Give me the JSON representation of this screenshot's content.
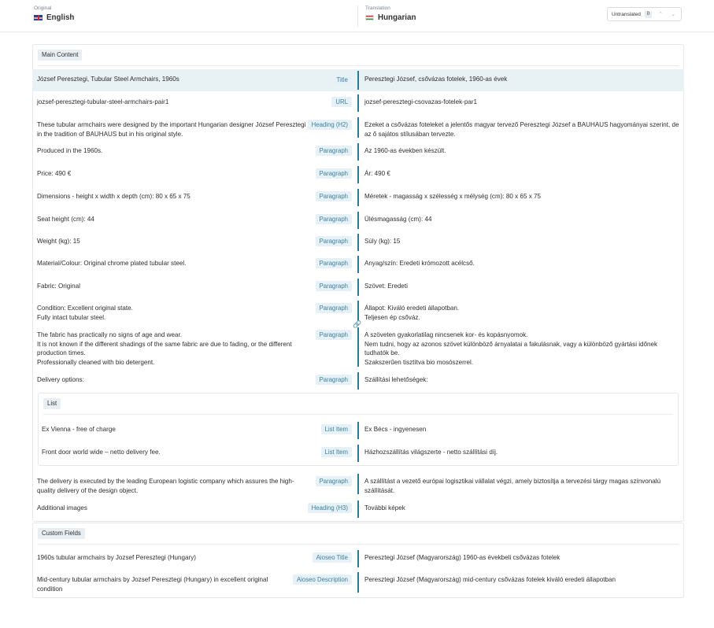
{
  "header": {
    "original_caption": "Original",
    "original_language": "English",
    "translation_caption": "Translation",
    "translation_language": "Hungarian",
    "untranslated_label": "Untranslated",
    "untranslated_count": "0",
    "prev_icon": "chevron-up-icon",
    "next_icon": "chevron-down-icon"
  },
  "main_content": {
    "label": "Main Content",
    "rows": [
      {
        "source": "József Peresztegi, Tubular Steel Armchairs, 1960s",
        "type": "Title",
        "translation": "Peresztegi József, csővázas fotelek, 1960-as évek"
      },
      {
        "source": "jozsef-peresztegi-tubular-steel-armchairs-pair1",
        "type": "URL",
        "translation": "jozsef-peresztegi-csovazas-fotelek-par1"
      },
      {
        "source": "These tubular armchairs were designed by the important Hungarian designer József Peresztegi in the tradition of BAUHAUS but in his original style.",
        "type": "Heading (H2)",
        "translation": "Ezeket a csővázas foteleket a jelentős magyar tervező Peresztegi József a BAUHAUS hagyományai szerint, de az ő sajátos stílusában tervezte."
      },
      {
        "source": "Produced in the 1960s.",
        "type": "Paragraph",
        "translation": "Az 1960-as években készült."
      },
      {
        "source": "Price: 490 €",
        "type": "Paragraph",
        "translation": "Ár: 490 €"
      },
      {
        "source": "Dimensions - height x width x depth (cm): 80 x 65 x 75",
        "type": "Paragraph",
        "translation": "Méretek - magasság x szélesség x mélység (cm): 80 x 65 x 75"
      },
      {
        "source": "Seat height (cm): 44",
        "type": "Paragraph",
        "translation": "Ülésmagasság (cm): 44"
      },
      {
        "source": "Weight (kg): 15",
        "type": "Paragraph",
        "translation": "Súly (kg): 15"
      },
      {
        "source": "Material/Colour: Original chrome plated tubular steel.",
        "type": "Paragraph",
        "translation": "Anyag/szín: Eredeti krómozott acélcső."
      },
      {
        "source": "Fabric: Original",
        "type": "Paragraph",
        "translation": "Szövet: Eredeti"
      },
      {
        "source": "Condition: Excellent original state.\nFully intact tubular steel.",
        "type": "Paragraph",
        "translation": "Állapot: Kiváló eredeti állapotban.\nTeljesen ép csőváz."
      },
      {
        "source": "The fabric has practically no signs of age and wear.\nIt is not known if the different shadings of the same fabric are due to fading, or the different production times.\nProfessionally cleaned with bio detergent.",
        "type": "Paragraph",
        "translation": "A szöveten gyakorlatilag nincsenek kor- és kopásnyomok.\nNem tudni, hogy az azonos szövet különböző árnyalatai a fakulásnak, vagy a különböző gyártási időnek tudhatók be.\nSzakszerűen tisztítva bio mosószerrel."
      },
      {
        "source": "Delivery options:",
        "type": "Paragraph",
        "translation": "Szállítási lehetőségek:"
      }
    ],
    "list": {
      "label": "List",
      "items": [
        {
          "source": "Ex Vienna - free of charge",
          "type": "List Item",
          "translation": "Ex Bécs - ingyenesen"
        },
        {
          "source": "Front door world wide – netto delivery fee.",
          "type": "List Item",
          "translation": "Házhozszállítás világszerte - netto szállítási díj."
        }
      ]
    },
    "after_rows": [
      {
        "source": "The delivery is executed by the leading European logistic company which assures the high-quality delivery of the design object.",
        "type": "Paragraph",
        "translation": "A szállítást a vezető európai logisztikai vállalat végzi, amely biztosítja a tervezési tárgy magas színvonalú szállítását."
      },
      {
        "source": "Additional images",
        "type": "Heading (H3)",
        "translation": "További képek"
      }
    ]
  },
  "custom_fields": {
    "label": "Custom Fields",
    "rows": [
      {
        "source": "1960s tubular armchairs by Jozsef Peresztegi (Hungary)",
        "type": "Aioseo Title",
        "translation": "Peresztegi József (Magyarország) 1960-as évekbeli csővázas fotelek"
      },
      {
        "source": "Mid-century tubular armchairs by Jozsef Peresztegi (Hungary) in excellent original condition",
        "type": "Aioseo Description",
        "translation": "Peresztegi József (Magyarország) mid-century csővázas fotelek kiváló eredeti állapotban"
      }
    ]
  },
  "link_icon": "link-icon"
}
